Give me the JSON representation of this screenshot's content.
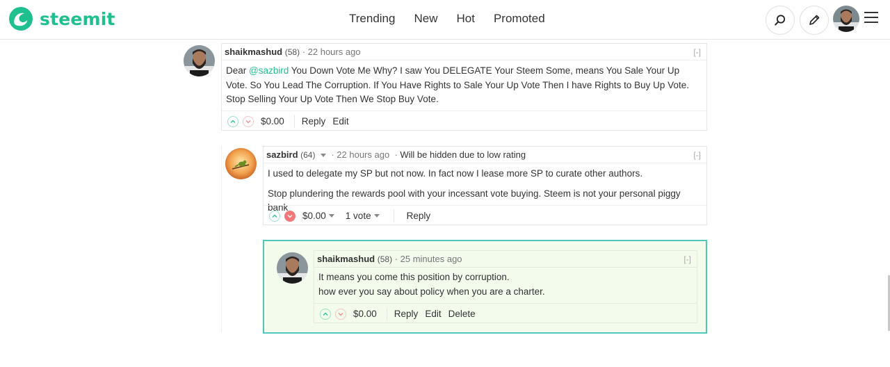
{
  "app": {
    "name": "steemit",
    "brand_color": "#1fbf8f",
    "highlight_border": "#4fc7bd"
  },
  "nav": {
    "items": [
      "Trending",
      "New",
      "Hot",
      "Promoted"
    ]
  },
  "header": {
    "search_icon": "search-icon",
    "edit_icon": "pencil-icon",
    "menu_icon": "hamburger-icon"
  },
  "comments": [
    {
      "author": "shaikmashud",
      "reputation": "(58)",
      "time": "22 hours ago",
      "collapse": "[-]",
      "body_pre": "Dear ",
      "mention": "@sazbird",
      "body_line1": " You Down Vote Me Why? I saw You DELEGATE Your Steem Some, means You Sale Your Up Vote. So You Lead The Corruption. If You Have Rights to Sale Your Up Vote Then I have Rights to Buy Up Vote.",
      "body_line2": "Stop Selling Your Up Vote Then We Stop Buy Vote.",
      "payout": "$0.00",
      "actions": [
        "Reply",
        "Edit"
      ]
    },
    {
      "author": "sazbird",
      "reputation": "(64)",
      "time": "22 hours ago",
      "notice": "Will be hidden due to low rating",
      "collapse": "[-]",
      "body_p1": "I used to delegate my SP but not now. In fact now I lease more SP to curate other authors.",
      "body_p2": "Stop plundering the rewards pool with your incessant vote buying. Steem is not your personal piggy bank",
      "payout": "$0.00",
      "votes": "1 vote",
      "actions": [
        "Reply"
      ]
    },
    {
      "author": "shaikmashud",
      "reputation": "(58)",
      "time": "25 minutes ago",
      "collapse": "[-]",
      "body_line1": "It means you come this position by corruption.",
      "body_line2": "how ever you say about policy when you are a charter.",
      "payout": "$0.00",
      "actions": [
        "Reply",
        "Edit",
        "Delete"
      ]
    }
  ]
}
